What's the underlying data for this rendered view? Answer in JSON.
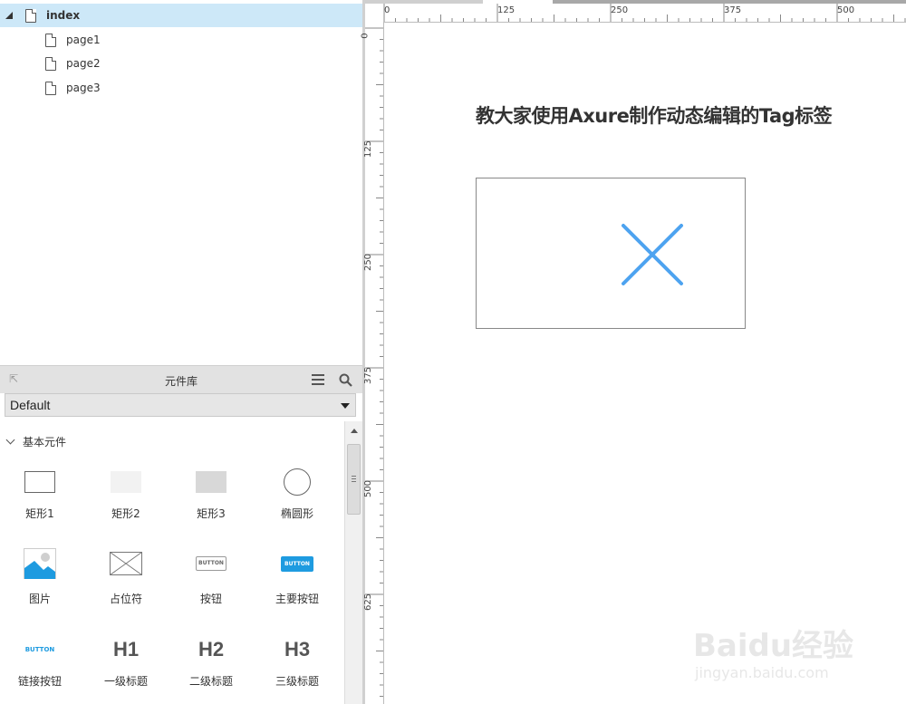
{
  "pages": {
    "root": "index",
    "children": [
      "page1",
      "page2",
      "page3"
    ]
  },
  "library": {
    "title": "元件库",
    "selected_library": "Default",
    "category": "基本元件",
    "widgets": [
      {
        "label": "矩形1",
        "icon": "rect-outline-icon"
      },
      {
        "label": "矩形2",
        "icon": "rect-light-icon"
      },
      {
        "label": "矩形3",
        "icon": "rect-gray-icon"
      },
      {
        "label": "椭圆形",
        "icon": "ellipse-icon"
      },
      {
        "label": "图片",
        "icon": "image-icon"
      },
      {
        "label": "占位符",
        "icon": "placeholder-icon"
      },
      {
        "label": "按钮",
        "icon": "button-icon",
        "thumb_text": "BUTTON"
      },
      {
        "label": "主要按钮",
        "icon": "primary-button-icon",
        "thumb_text": "BUTTON"
      },
      {
        "label": "链接按钮",
        "icon": "link-button-icon",
        "thumb_text": "BUTTON"
      },
      {
        "label": "一级标题",
        "icon": "h1-icon",
        "thumb_text": "H1"
      },
      {
        "label": "二级标题",
        "icon": "h2-icon",
        "thumb_text": "H2"
      },
      {
        "label": "三级标题",
        "icon": "h3-icon",
        "thumb_text": "H3"
      }
    ]
  },
  "rulers": {
    "top": [
      "0",
      "125",
      "250",
      "375",
      "500"
    ],
    "left": [
      "0",
      "125",
      "250",
      "375",
      "500",
      "625"
    ]
  },
  "canvas": {
    "title": "教大家使用Axure制作动态编辑的Tag标签"
  },
  "colors": {
    "accent": "#4da3f0",
    "selected_row": "#cde8f8",
    "primary_button": "#1e9be0"
  },
  "watermark": {
    "brand": "Baidu经验",
    "url": "jingyan.baidu.com"
  }
}
